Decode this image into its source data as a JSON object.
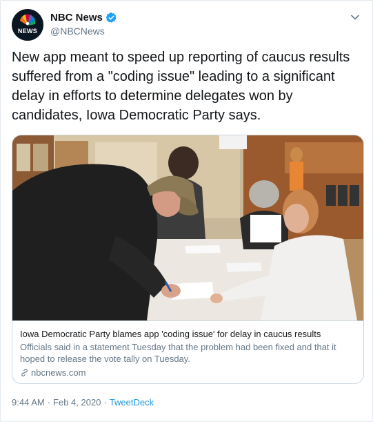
{
  "account": {
    "display_name": "NBC News",
    "handle": "@NBCNews",
    "avatar_text": "NEWS",
    "verified": true
  },
  "tweet": {
    "text": "New app meant to speed up reporting of caucus results suffered from a \"coding issue\" leading to a significant delay in efforts to determine delegates won by candidates, Iowa Democratic Party says."
  },
  "card": {
    "image_icon": "photo-caucus-voters-signing-in",
    "title": "Iowa Democratic Party blames app 'coding issue' for delay in caucus results",
    "description": "Officials said in a statement Tuesday that the problem had been fixed and that it hoped to release the vote tally on Tuesday.",
    "domain": "nbcnews.com",
    "link_icon": "link-icon"
  },
  "meta": {
    "time": "9:44 AM",
    "separator": "·",
    "date": "Feb 4, 2020",
    "source": "TweetDeck"
  },
  "colors": {
    "text": "#14171a",
    "secondary": "#657786",
    "accent": "#1b95e0",
    "border": "#ccd6dd"
  }
}
